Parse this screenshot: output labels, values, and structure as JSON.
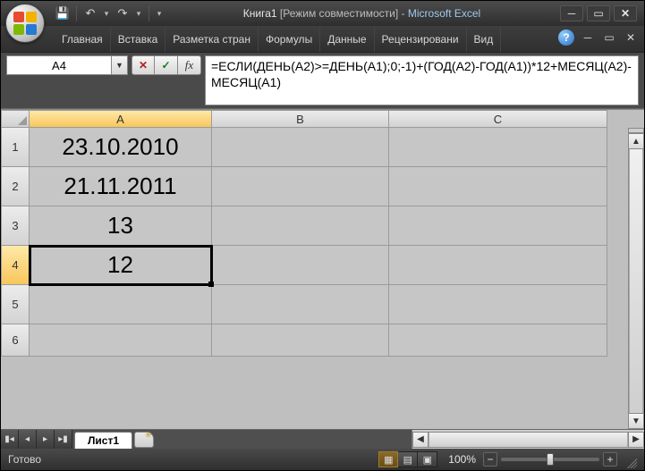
{
  "title": {
    "doc": "Книга1",
    "mode": "[Режим совместимости]",
    "sep": " - ",
    "app": "Microsoft Excel"
  },
  "qat": {
    "save_icon": "💾",
    "undo_icon": "↶",
    "redo_icon": "↷"
  },
  "tabs": {
    "home": "Главная",
    "insert": "Вставка",
    "page_layout": "Разметка стран",
    "formulas": "Формулы",
    "data": "Данные",
    "review": "Рецензировани",
    "view": "Вид"
  },
  "name_box": {
    "value": "A4"
  },
  "formula_bar": {
    "cancel": "✕",
    "confirm": "✓",
    "fx": "fx",
    "value": "=ЕСЛИ(ДЕНЬ(A2)>=ДЕНЬ(A1);0;-1)+(ГОД(A2)-ГОД(A1))*12+МЕСЯЦ(A2)-МЕСЯЦ(A1)"
  },
  "columns": {
    "A": "A",
    "B": "B",
    "C": "C"
  },
  "row_headers": {
    "r1": "1",
    "r2": "2",
    "r3": "3",
    "r4": "4",
    "r5": "5",
    "r6": "6"
  },
  "cells": {
    "A1": "23.10.2010",
    "A2": "21.11.2011",
    "A3": "13",
    "A4": "12"
  },
  "selected_cell": "A4",
  "sheet_tabs": {
    "sheet1": "Лист1"
  },
  "statusbar": {
    "ready": "Готово",
    "zoom_label": "100%"
  },
  "zoom": {
    "value": 100,
    "min": 10,
    "max": 400
  }
}
